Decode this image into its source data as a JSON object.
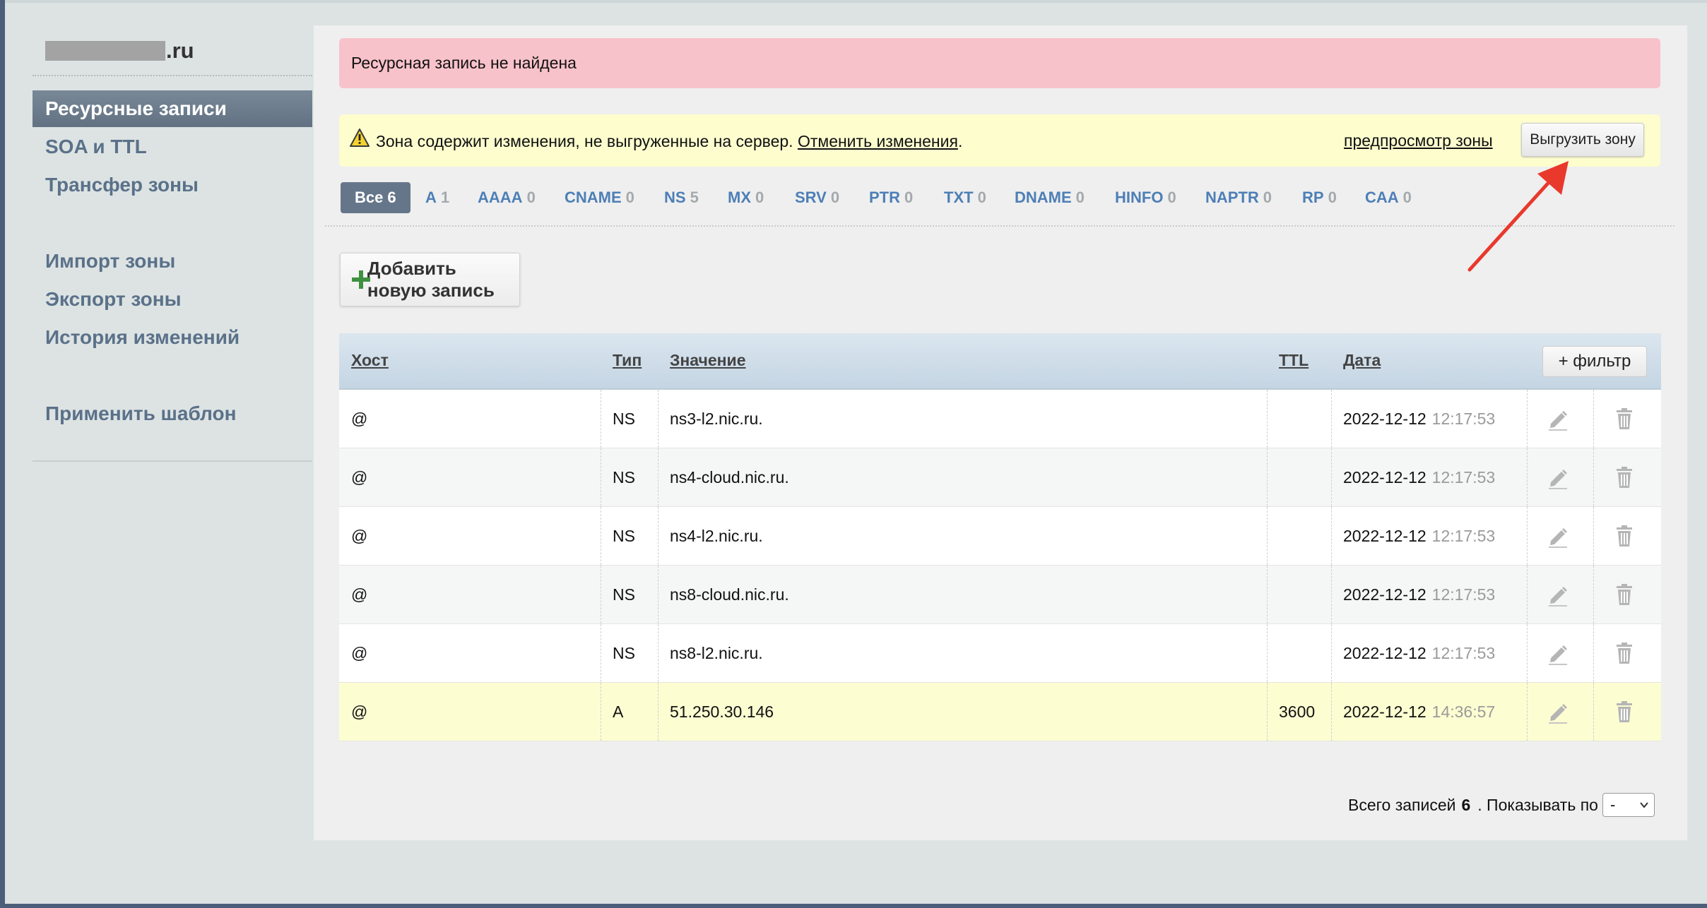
{
  "sidebar": {
    "zone_suffix": ".ru",
    "items": [
      {
        "label": "Ресурсные записи",
        "active": true
      },
      {
        "label": "SOA и TTL"
      },
      {
        "label": "Трансфер зоны"
      },
      {
        "label": "Импорт зоны"
      },
      {
        "label": "Экспорт зоны"
      },
      {
        "label": "История изменений"
      },
      {
        "label": "Применить шаблон"
      }
    ]
  },
  "alerts": {
    "error": "Ресурсная запись не найдена",
    "warning": {
      "text": "Зона содержит изменения, не выгруженные на сервер.",
      "cancel_link": "Отменить изменения",
      "period": ".",
      "preview_link": "предпросмотр зоны",
      "upload_button": "Выгрузить зону"
    }
  },
  "tabs": [
    {
      "label": "Все",
      "count": "6",
      "active": true
    },
    {
      "label": "A",
      "count": "1"
    },
    {
      "label": "AAAA",
      "count": "0"
    },
    {
      "label": "CNAME",
      "count": "0"
    },
    {
      "label": "NS",
      "count": "5"
    },
    {
      "label": "MX",
      "count": "0"
    },
    {
      "label": "SRV",
      "count": "0"
    },
    {
      "label": "PTR",
      "count": "0"
    },
    {
      "label": "TXT",
      "count": "0"
    },
    {
      "label": "DNAME",
      "count": "0"
    },
    {
      "label": "HINFO",
      "count": "0"
    },
    {
      "label": "NAPTR",
      "count": "0"
    },
    {
      "label": "RP",
      "count": "0"
    },
    {
      "label": "CAA",
      "count": "0"
    }
  ],
  "add_button": "Добавить новую запись",
  "table": {
    "columns": {
      "host": "Хост",
      "type": "Тип",
      "value": "Значение",
      "ttl": "TTL",
      "date": "Дата"
    },
    "filter_button": "+ фильтр",
    "rows": [
      {
        "host": "@",
        "type": "NS",
        "value": "ns3-l2.nic.ru.",
        "ttl": "",
        "date": "2022-12-12",
        "time": "12:17:53"
      },
      {
        "host": "@",
        "type": "NS",
        "value": "ns4-cloud.nic.ru.",
        "ttl": "",
        "date": "2022-12-12",
        "time": "12:17:53"
      },
      {
        "host": "@",
        "type": "NS",
        "value": "ns4-l2.nic.ru.",
        "ttl": "",
        "date": "2022-12-12",
        "time": "12:17:53"
      },
      {
        "host": "@",
        "type": "NS",
        "value": "ns8-cloud.nic.ru.",
        "ttl": "",
        "date": "2022-12-12",
        "time": "12:17:53"
      },
      {
        "host": "@",
        "type": "NS",
        "value": "ns8-l2.nic.ru.",
        "ttl": "",
        "date": "2022-12-12",
        "time": "12:17:53"
      },
      {
        "host": "@",
        "type": "A",
        "value": "51.250.30.146",
        "ttl": "3600",
        "date": "2022-12-12",
        "time": "14:36:57",
        "highlighted": true
      }
    ]
  },
  "footer": {
    "total_label": "Всего записей",
    "total": "6",
    "show_label": ". Показывать по",
    "per_page": "-"
  },
  "colors": {
    "accent_tab": "#66768a",
    "link": "#4d7fb6",
    "error_bg": "#f8c2ca",
    "warn_bg": "#fdfdce",
    "highlight_row": "#fdfdd2",
    "annotation": "#e8392c"
  },
  "icons": [
    "warning-icon",
    "plus-icon",
    "edit-icon",
    "delete-icon",
    "chevron-down-icon",
    "annotation-arrow"
  ]
}
